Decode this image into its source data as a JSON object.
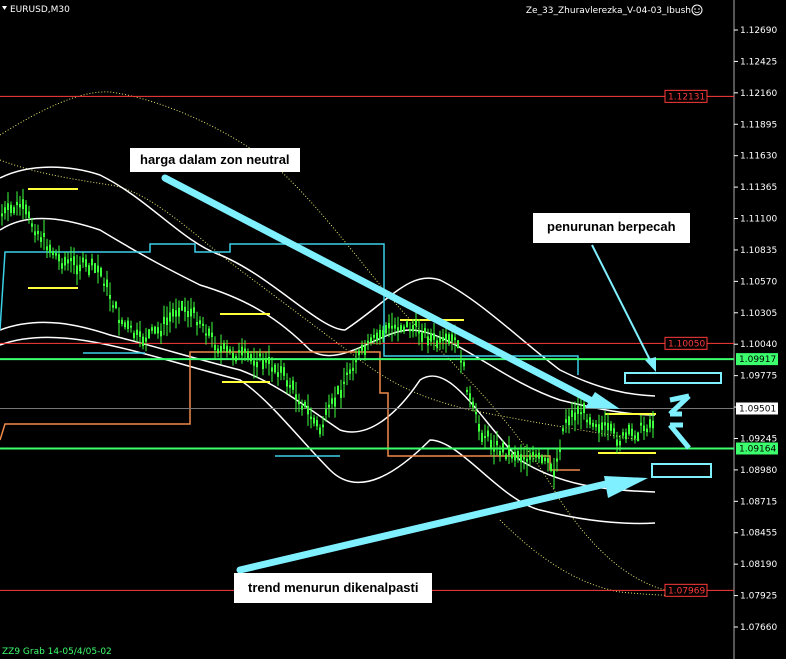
{
  "header": {
    "symbol": "EURUSD,M30",
    "indicator": "Ze_33_Zhuravlerezka_V-04-03_Ibush",
    "footer": "ZZ9 Grab 14-05/4/05-02"
  },
  "icons": {
    "dropdown": "triangle-down-icon",
    "smiley": "smiley-face-icon"
  },
  "annotations": {
    "neutral": "harga dalam zon neutral",
    "breakout": "penurunan berpecah",
    "downtrend": "trend menurun dikenalpasti"
  },
  "price_levels": [
    {
      "value": "1.12131",
      "price": 1.12131,
      "color": "#ff3b3b"
    },
    {
      "value": "1.10050",
      "price": 1.1005,
      "color": "#ff3b3b"
    },
    {
      "value": "1.09917",
      "price": 1.09917,
      "color": "#3cff6e"
    },
    {
      "value": "1.09501",
      "price": 1.09501,
      "color": "#ffffff"
    },
    {
      "value": "1.09164",
      "price": 1.09164,
      "color": "#3cff6e"
    },
    {
      "value": "1.07969",
      "price": 1.07969,
      "color": "#ff3b3b"
    }
  ],
  "axis": {
    "ticks": [
      "1.12690",
      "1.12425",
      "1.12160",
      "1.11895",
      "1.11630",
      "1.11365",
      "1.11100",
      "1.10835",
      "1.10570",
      "1.10305",
      "1.10040",
      "1.09775",
      "1.09510",
      "1.09245",
      "1.08980",
      "1.08715",
      "1.08455",
      "1.08190",
      "1.07925",
      "1.07660"
    ],
    "max": 1.1269,
    "min": 1.0766
  },
  "colors": {
    "background": "#000000",
    "candle": "#3cff3c",
    "bands": "#ffffff",
    "cyan": "#3ccfe8",
    "orange": "#f08b4a",
    "arrow": "#7ff0ff"
  }
}
